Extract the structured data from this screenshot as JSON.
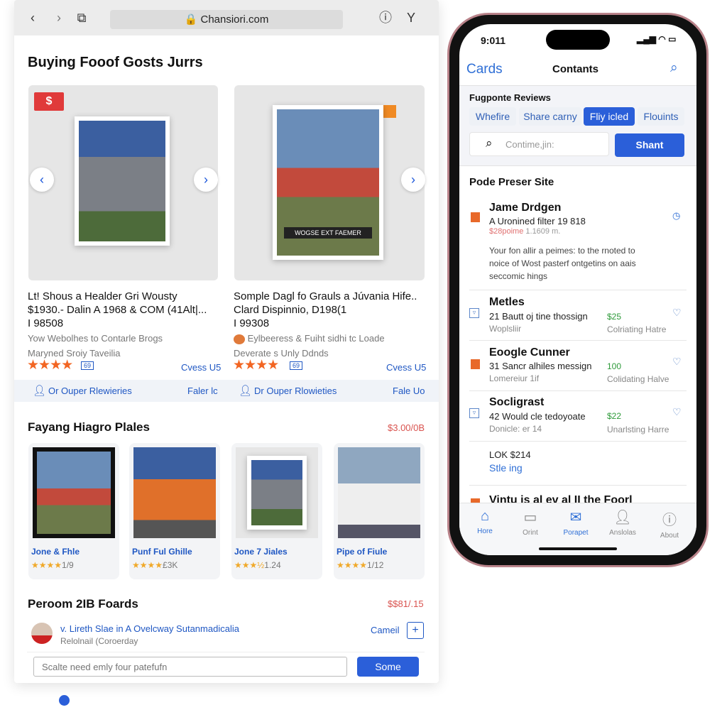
{
  "browser": {
    "url": "Chansiori.com",
    "nav": [
      "back-icon",
      "forward-icon",
      "tabs-icon"
    ],
    "actions": [
      "info-icon",
      "filter-icon"
    ]
  },
  "section1": {
    "title": "Buying Fooof Gosts Jurrs",
    "cards": [
      {
        "badge": "$",
        "banner": "",
        "title1": "Lt! Shous a Healder Gri Wousty",
        "title2": "$1930.- Dalin A 1968 & COM (41Alt|...",
        "code": "I 98508",
        "desc": "Yow Webolhes to Contarle Brogs",
        "seller": "Maryned Sroiy Taveilia",
        "rating": 4,
        "rating_badge": "69",
        "link": "Cvess U5",
        "footer_label": "Or Ouper Rlewieries",
        "footer_action": "Faler lc"
      },
      {
        "badge": "",
        "banner": "WOGSE EXT FAEMER",
        "title1": "Somple Dagl fo Grauls a Júvania Hife..",
        "title2": "Clard Dispinnio, D198(1",
        "code": "I 99308",
        "desc": "Eylbeeress & Fuiht sidhi tc Loade",
        "seller": "Deverate s Unly Ddnds",
        "rating": 4,
        "rating_badge": "69",
        "link": "Cvess U5",
        "footer_label": "Dr Ouper Rlowieties",
        "footer_action": "Fale Uo"
      }
    ]
  },
  "section2": {
    "title": "Fayang Hiagro Plales",
    "price": "$3.00/0B",
    "items": [
      {
        "name": "Jone & Fhle",
        "stars": "★★★★",
        "count": "1/9"
      },
      {
        "name": "Punf Ful Ghille",
        "stars": "★★★★",
        "count": "£3K"
      },
      {
        "name": "Jone 7 Jiales",
        "stars": "★★★½",
        "count": "1.24"
      },
      {
        "name": "Pipe of Fiule",
        "stars": "★★★★",
        "count": "1/12"
      }
    ]
  },
  "section3": {
    "title": "Peroom 2IB Foards",
    "price": "$$81/.15",
    "row_title": "v. Lireth Slae in A Ovelcway Sutanmadicalia",
    "row_sub": "Relolnail (Coroerday",
    "row_action": "Cameil",
    "input_placeholder": "Scalte need emly four patefufn",
    "submit": "Some"
  },
  "phone": {
    "time": "9:011",
    "back": "Cards",
    "title": "Contants",
    "filters_title": "Fugponte Reviews",
    "chips": [
      "Whefire",
      "Share carny",
      "Fliy icled",
      "Flouints"
    ],
    "active_chip": 2,
    "search_placeholder": "Contime,jin:",
    "search_button": "Shant",
    "list_title": "Pode Preser Site",
    "items": [
      {
        "title": "Jame Drdgen",
        "sub": "A Uronined filter 19 818",
        "price_red": "$28poime",
        "meta": "1.1609 m.",
        "body": "Your fon allir a peimes: to the rnoted to noice of Wost pasterf ontgetins on aais seccomic hings"
      },
      {
        "title": "Metles",
        "sub": "21 Bautt oj tine thossign",
        "meta": "Woplsliir",
        "price": "$25",
        "status": "Colriating Hatre"
      },
      {
        "title": "Eoogle Cunner",
        "sub": "31 Sancr alhiles messign",
        "meta": "Lomereiur 1if",
        "price": "100",
        "status": "Colidating Halve"
      },
      {
        "title": "Socligrast",
        "sub": "42 Would cle tedoyoate",
        "meta": "Donicle: er 14",
        "price": "$22",
        "status": "Unarlsting Harre"
      }
    ],
    "extra_line1": "LOK $214",
    "extra_line2": "Stle ing",
    "cut_title": "Vintu is al ev al II the Foorl",
    "tabs": [
      {
        "label": "Hore",
        "icon": "home-icon"
      },
      {
        "label": "Orint",
        "icon": "tablet-icon"
      },
      {
        "label": "Porapet",
        "icon": "mail-icon"
      },
      {
        "label": "Anslolas",
        "icon": "person-icon"
      },
      {
        "label": "About",
        "icon": "info-icon"
      }
    ],
    "active_tab": 0
  },
  "colors": {
    "accent": "#2b5fd9",
    "star": "#f26522",
    "price_green": "#2e9a3a",
    "price_red": "#d9534f"
  }
}
